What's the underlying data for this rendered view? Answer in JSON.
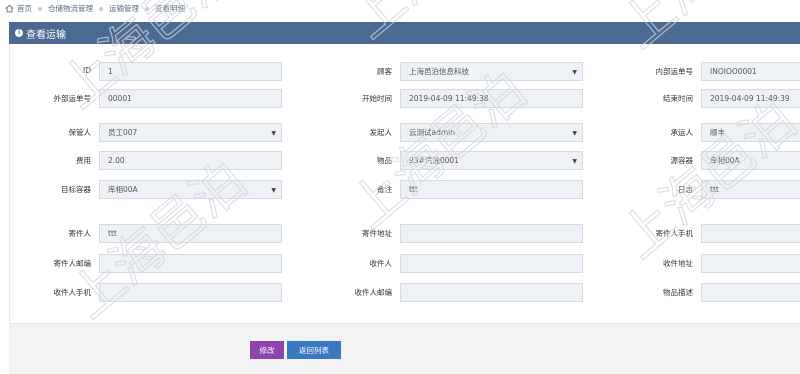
{
  "breadcrumb": [
    "首页",
    "仓储物流管理",
    "运输管理",
    "查看明细"
  ],
  "panel_title": "查看运输",
  "rows": [
    [
      {
        "label": "ID",
        "value": "1",
        "select": false
      },
      {
        "label": "顾客",
        "value": "上海邑泊信息科技",
        "select": true
      },
      {
        "label": "内部运单号",
        "value": "INOIOO0001",
        "select": false
      }
    ],
    [
      {
        "label": "外部运单号",
        "value": "00001",
        "select": false
      },
      {
        "label": "开始时间",
        "value": "2019-04-09 11:49:38",
        "select": false
      },
      {
        "label": "结束时间",
        "value": "2019-04-09 11:49:39",
        "select": false
      }
    ],
    [
      {
        "label": "保管人",
        "value": "员工007",
        "select": true
      },
      {
        "label": "发起人",
        "value": "云测试admin",
        "select": true
      },
      {
        "label": "承运人",
        "value": "顺丰",
        "select": false
      }
    ],
    [
      {
        "label": "费用",
        "value": "2.00",
        "select": false
      },
      {
        "label": "物品",
        "value": "93#汽油0001",
        "select": true
      },
      {
        "label": "源容器",
        "value": "库相00A",
        "select": false
      }
    ],
    [
      {
        "label": "目标容器",
        "value": "库相00A",
        "select": true
      },
      {
        "label": "备注",
        "value": "ttt",
        "select": false
      },
      {
        "label": "日志",
        "value": "ttt",
        "select": false
      }
    ],
    [
      {
        "label": "寄件人",
        "value": "ttt",
        "select": false
      },
      {
        "label": "寄件地址",
        "value": "",
        "select": false
      },
      {
        "label": "寄件人手机",
        "value": "",
        "select": false
      }
    ],
    [
      {
        "label": "寄件人邮编",
        "value": "",
        "select": false
      },
      {
        "label": "收件人",
        "value": "",
        "select": false
      },
      {
        "label": "收件地址",
        "value": "",
        "select": false
      }
    ],
    [
      {
        "label": "收件人手机",
        "value": "",
        "select": false
      },
      {
        "label": "收件人邮编",
        "value": "",
        "select": false
      },
      {
        "label": "物品描述",
        "value": "",
        "select": false
      }
    ]
  ],
  "buttons": {
    "edit": "修改",
    "back": "返回列表"
  },
  "watermark_text": "上海邑泊",
  "colors": {
    "header": "#4b6a92",
    "edit_button": "#8f44ad",
    "back_button": "#3a78c3",
    "input_bg": "#eef1f5"
  },
  "icons": {
    "home": "home-icon",
    "header": "info-circle-icon",
    "select": "caret-down-icon"
  }
}
